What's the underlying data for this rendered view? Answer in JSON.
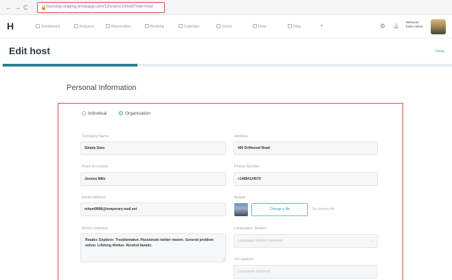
{
  "browser": {
    "back": "←",
    "forward": "→",
    "reload": "C",
    "url": "foursday-staging.lenskapp.com/12/users/10/edit?role=host"
  },
  "header": {
    "logo": "H",
    "menu": [
      {
        "label": "Dashboard"
      },
      {
        "label": "Request"
      },
      {
        "label": "Reservation"
      },
      {
        "label": "Booking"
      },
      {
        "label": "Calendar"
      },
      {
        "label": "Guest"
      },
      {
        "label": "Host"
      },
      {
        "label": "Stay"
      },
      {
        "label": "▾"
      }
    ],
    "settings_icon": "⚙",
    "bell_icon": "🔔",
    "welcome": "Welcome back! Admin"
  },
  "page": {
    "title": "Edit host",
    "close_label": "Close",
    "progress": 0.3
  },
  "form": {
    "section_title": "Personal Information",
    "radio_individual": "Individual",
    "radio_organisation": "Organisation",
    "company_name_label": "Company Name",
    "company_name_value": "Simply Save",
    "address_label": "Address",
    "address_value": "400 Driftwood Road",
    "point_of_contact_label": "Point of contact",
    "point_of_contact_value": "Jessica Mills",
    "phone_label": "Phone Number",
    "phone_value": "+14084124579",
    "email_label": "Email address",
    "email_value": "mhunt9986@temporary-mail.net",
    "avatar_label": "Avatar",
    "avatar_button": "Change a file",
    "avatar_note": "No chosen file",
    "about_label": "About company",
    "about_value": "Reader. Explorer. Troublemaker. Passionate twitter maven. General problem solver. Lifelong thinker. Alcohol fanatic.",
    "languages_label": "Languages Spoken",
    "languages_placeholder": "Languages Spoken (optional)",
    "occupation_label": "Occupation",
    "occupation_placeholder": "Occupation (optional)"
  }
}
